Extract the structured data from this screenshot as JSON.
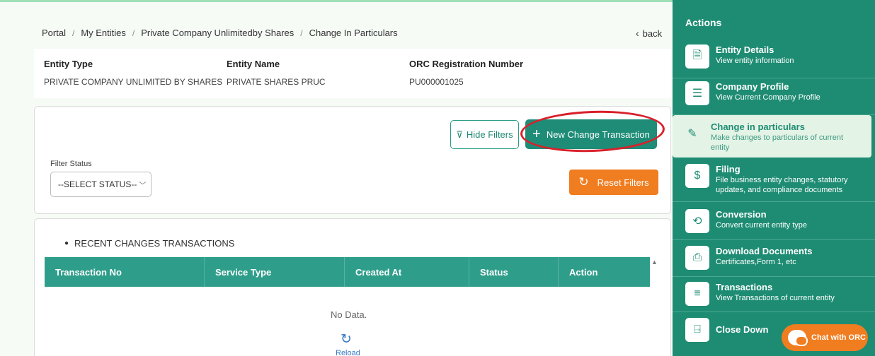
{
  "breadcrumb": [
    "Portal",
    "My Entities",
    "Private Company Unlimitedby Shares",
    "Change In Particulars"
  ],
  "back_label": "back",
  "entity": {
    "type_label": "Entity Type",
    "type_value": "PRIVATE COMPANY UNLIMITED BY SHARES",
    "name_label": "Entity Name",
    "name_value": "PRIVATE SHARES PRUC",
    "orc_label": "ORC Registration Number",
    "orc_value": "PU000001025"
  },
  "filters": {
    "hide_label": "Hide Filters",
    "new_label": "New Change Transaction",
    "status_label": "Filter Status",
    "status_selected": "--SELECT STATUS--",
    "reset_label": "Reset Filters"
  },
  "transactions": {
    "title": "RECENT CHANGES TRANSACTIONS",
    "columns": [
      "Transaction No",
      "Service Type",
      "Created At",
      "Status",
      "Action"
    ],
    "empty_text": "No Data.",
    "reload_label": "Reload"
  },
  "sidebar": {
    "title": "Actions",
    "items": [
      {
        "name": "Entity Details",
        "desc": "View entity information",
        "icon": "document-search-icon"
      },
      {
        "name": "Company Profile",
        "desc": "View Current Company Profile",
        "icon": "list-icon"
      },
      {
        "name": "Change in particulars",
        "desc": "Make changes to particulars of current entity",
        "icon": "pencil-icon"
      },
      {
        "name": "Filing",
        "desc": "File business entity changes, statutory updates, and compliance documents",
        "icon": "money-bag-icon"
      },
      {
        "name": "Conversion",
        "desc": "Convert current entity type",
        "icon": "document-refresh-icon"
      },
      {
        "name": "Download Documents",
        "desc": "Certificates,Form 1, etc",
        "icon": "printer-icon"
      },
      {
        "name": "Transactions",
        "desc": "View Transactions of current entity",
        "icon": "list-lines-icon"
      },
      {
        "name": "Close Down",
        "desc": "",
        "icon": "door-icon"
      }
    ]
  },
  "chat_label": "Chat with ORC",
  "colors": {
    "primary": "#1e8c73",
    "accent": "#f07d20",
    "highlight": "#d9202a"
  }
}
